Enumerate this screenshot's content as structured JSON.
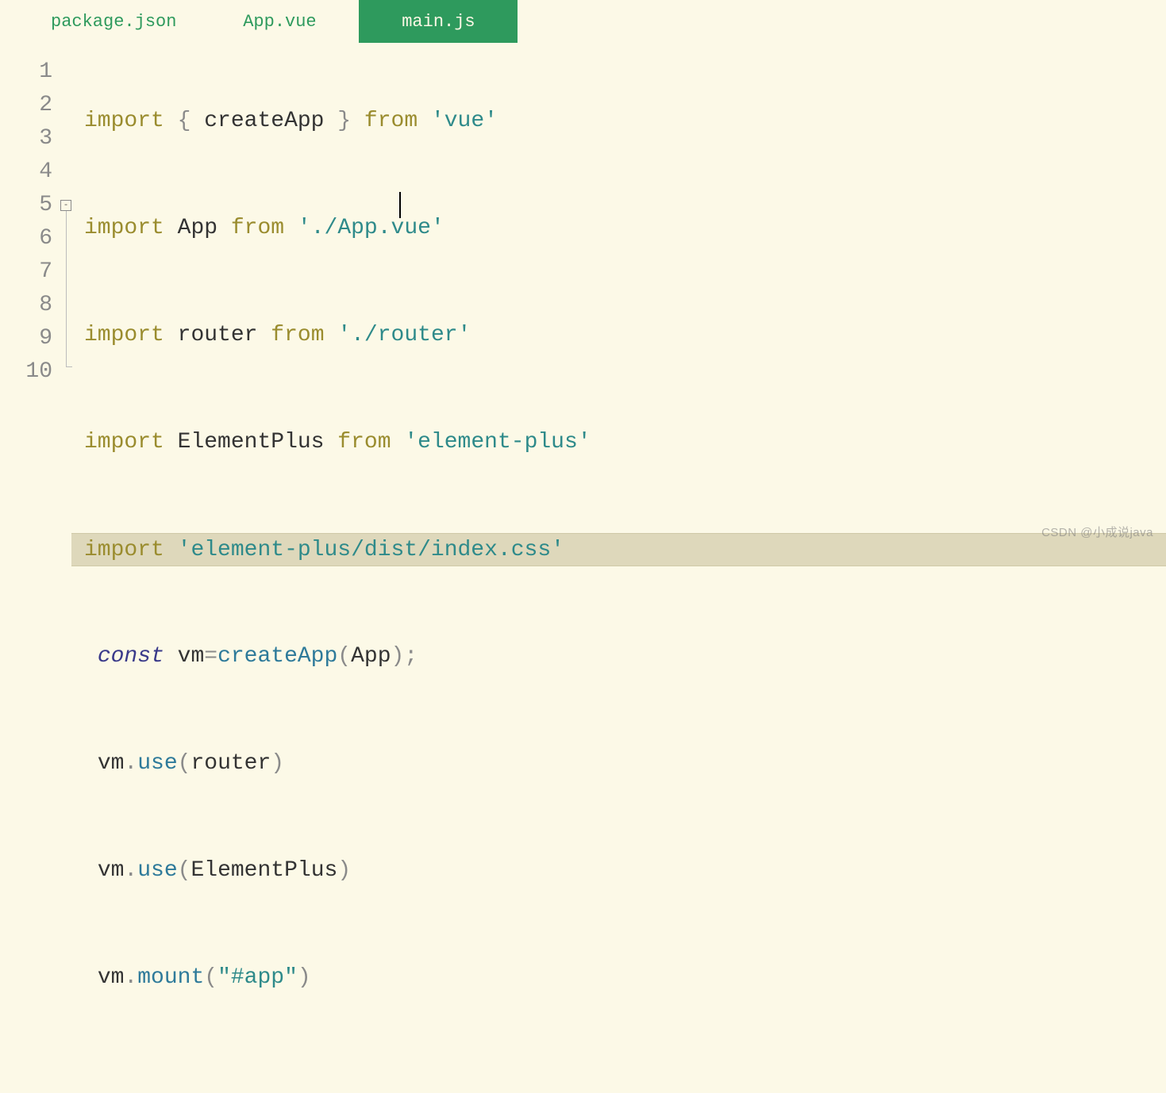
{
  "tabs": [
    {
      "label": "package.json",
      "active": false
    },
    {
      "label": "App.vue",
      "active": false
    },
    {
      "label": "main.js",
      "active": true
    }
  ],
  "gutter": [
    "1",
    "2",
    "3",
    "4",
    "5",
    "6",
    "7",
    "8",
    "9",
    "10"
  ],
  "fold": {
    "line": 5,
    "lastLine": 10,
    "glyph": "-"
  },
  "cursor": {
    "line": 5,
    "col": 26
  },
  "code": {
    "l1": {
      "kw": "import",
      "lb": " { ",
      "id": "createApp",
      "rb": " } ",
      "from": "from",
      "sp": " ",
      "q1": "'",
      "str": "vue",
      "q2": "'"
    },
    "l2": {
      "kw": "import",
      "sp1": " ",
      "id": "App",
      "sp2": " ",
      "from": "from",
      "sp3": " ",
      "q1": "'",
      "str": "./App.vue",
      "q2": "'"
    },
    "l3": {
      "kw": "import",
      "sp1": " ",
      "id": "router",
      "sp2": " ",
      "from": "from",
      "sp3": " ",
      "q1": "'",
      "str": "./router",
      "q2": "'"
    },
    "l4": {
      "kw": "import",
      "sp1": " ",
      "id": "ElementPlus",
      "sp2": " ",
      "from": "from",
      "sp3": " ",
      "q1": "'",
      "str": "element-plus",
      "q2": "'"
    },
    "l5": {
      "kw": "import",
      "sp1": " ",
      "q1": "'",
      "str": "element-plus/dist/index.css",
      "q2": "'"
    },
    "l6": {
      "ind": " ",
      "const": "const",
      "sp1": " ",
      "id": "vm",
      "eq": "=",
      "call": "createApp",
      "lp": "(",
      "arg": "App",
      "rp": ")",
      "semi": ";"
    },
    "l7": {
      "ind": " ",
      "obj": "vm",
      "dot": ".",
      "call": "use",
      "lp": "(",
      "arg": "router",
      "rp": ")"
    },
    "l8": {
      "ind": " ",
      "obj": "vm",
      "dot": ".",
      "call": "use",
      "lp": "(",
      "arg": "ElementPlus",
      "rp": ")"
    },
    "l9": {
      "ind": " ",
      "obj": "vm",
      "dot": ".",
      "call": "mount",
      "lp": "(",
      "q1": "\"",
      "arg": "#app",
      "q2": "\"",
      "rp": ")"
    }
  },
  "watermark": "CSDN @小成说java"
}
